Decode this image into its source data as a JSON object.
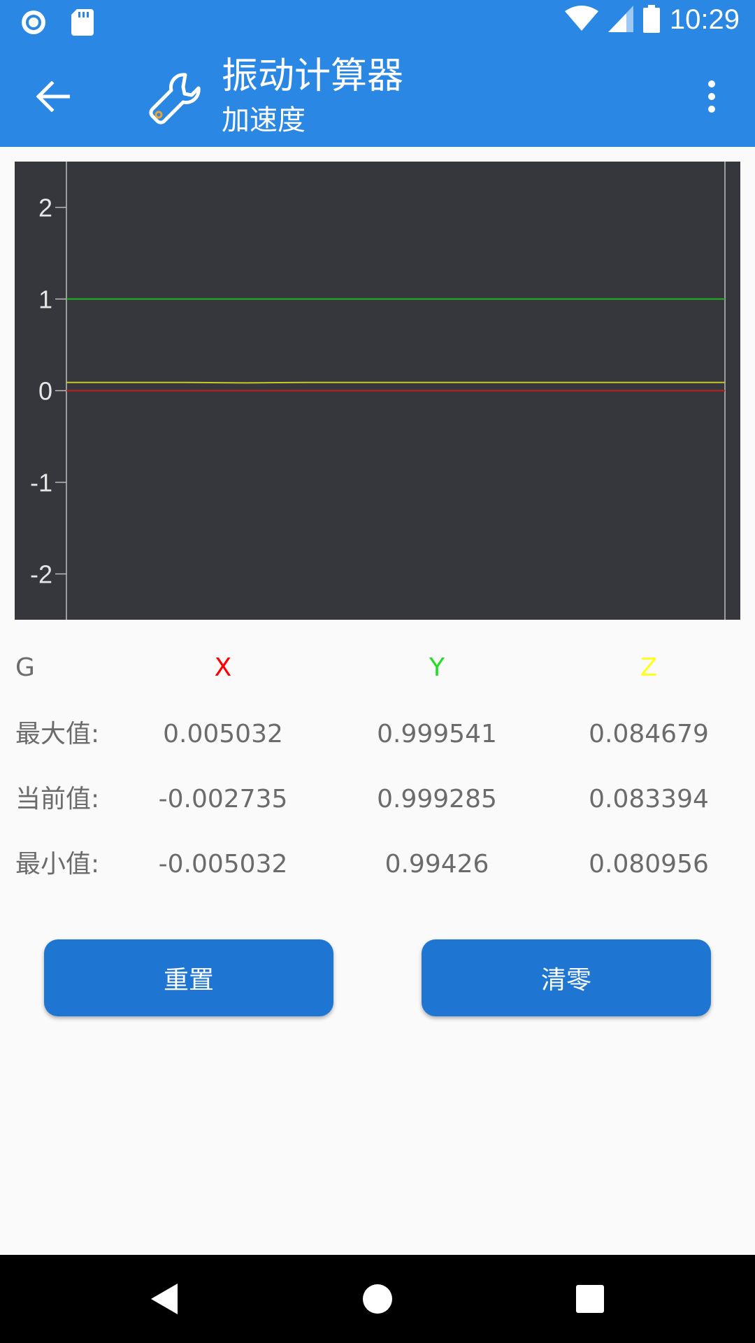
{
  "status_bar": {
    "time": "10:29",
    "icons": [
      "record-icon",
      "sd-card-icon",
      "wifi-icon",
      "signal-icon",
      "battery-icon"
    ]
  },
  "app_bar": {
    "title": "振动计算器",
    "subtitle": "加速度",
    "icons": [
      "back-arrow-icon",
      "wrench-icon",
      "more-vert-icon"
    ]
  },
  "chart_data": {
    "type": "line",
    "title": "",
    "xlabel": "",
    "ylabel": "",
    "ylim": [
      -2.5,
      2.5
    ],
    "yticks": [
      "2",
      "1",
      "0",
      "-1",
      "-2"
    ],
    "grid": false,
    "series": [
      {
        "color": "#1fb51f",
        "values": [
          1.0,
          1.0,
          1.0,
          1.0,
          1.0,
          1.0,
          1.0,
          1.0,
          1.0,
          1.0,
          1.0,
          1.0
        ]
      },
      {
        "color": "#c9c627",
        "values": [
          0.09,
          0.09,
          0.09,
          0.085,
          0.09,
          0.09,
          0.09,
          0.09,
          0.09,
          0.09,
          0.09,
          0.09
        ]
      },
      {
        "color": "#c01f1f",
        "values": [
          0.0,
          0.0,
          0.0,
          0.0,
          0.0,
          0.0,
          0.0,
          0.0,
          0.0,
          0.0,
          0.0,
          0.0
        ]
      }
    ],
    "background": "#35373d"
  },
  "table": {
    "unit": "G",
    "columns": [
      {
        "label": "X",
        "color": "#ff0000"
      },
      {
        "label": "Y",
        "color": "#22dd22"
      },
      {
        "label": "Z",
        "color": "#ffff22"
      }
    ],
    "rows": [
      {
        "label": "最大值:",
        "x": "0.005032",
        "y": "0.999541",
        "z": "0.084679"
      },
      {
        "label": "当前值:",
        "x": "-0.002735",
        "y": "0.999285",
        "z": "0.083394"
      },
      {
        "label": "最小值:",
        "x": "-0.005032",
        "y": "0.99426",
        "z": "0.080956"
      }
    ]
  },
  "buttons": {
    "reset": "重置",
    "zero": "清零"
  },
  "nav_bar": {
    "icons": [
      "back-triangle-icon",
      "home-circle-icon",
      "recents-square-icon"
    ]
  },
  "colors": {
    "primary": "#2a87e4",
    "button": "#1f76d2"
  }
}
